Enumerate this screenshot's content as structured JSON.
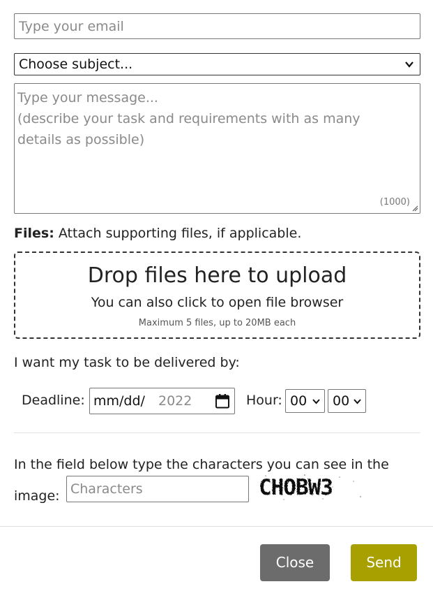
{
  "form": {
    "email": {
      "placeholder": "Type your email",
      "value": ""
    },
    "subject": {
      "selected": "Choose subject..."
    },
    "message": {
      "placeholder_line1": "Type your message...",
      "placeholder_line2": "(describe your task and requirements with as many details as possible)",
      "counter": "(1000)"
    },
    "files": {
      "label_bold": "Files:",
      "label_text": " Attach supporting files, if applicable.",
      "drop_title": "Drop files here to upload",
      "drop_subtitle": "You can also click to open file browser",
      "drop_note": "Maximum 5 files, up to 20MB each"
    },
    "delivery": {
      "label": "I want my task to be delivered by:",
      "deadline_label": "Deadline:",
      "deadline_value": "mm/dd/",
      "deadline_year_placeholder": "2022",
      "hour_label": "Hour:",
      "hour_value": "00",
      "minute_value": "00"
    },
    "captcha": {
      "instruction": "In the field below type the characters you can see in the image:",
      "placeholder": "Characters",
      "image_text": "CHOBW3"
    }
  },
  "buttons": {
    "close": "Close",
    "send": "Send"
  },
  "colors": {
    "close_bg": "#6c6c6c",
    "send_bg": "#a7a000"
  },
  "icons": [
    "chevron-down-icon",
    "calendar-icon",
    "resize-grip-icon"
  ]
}
